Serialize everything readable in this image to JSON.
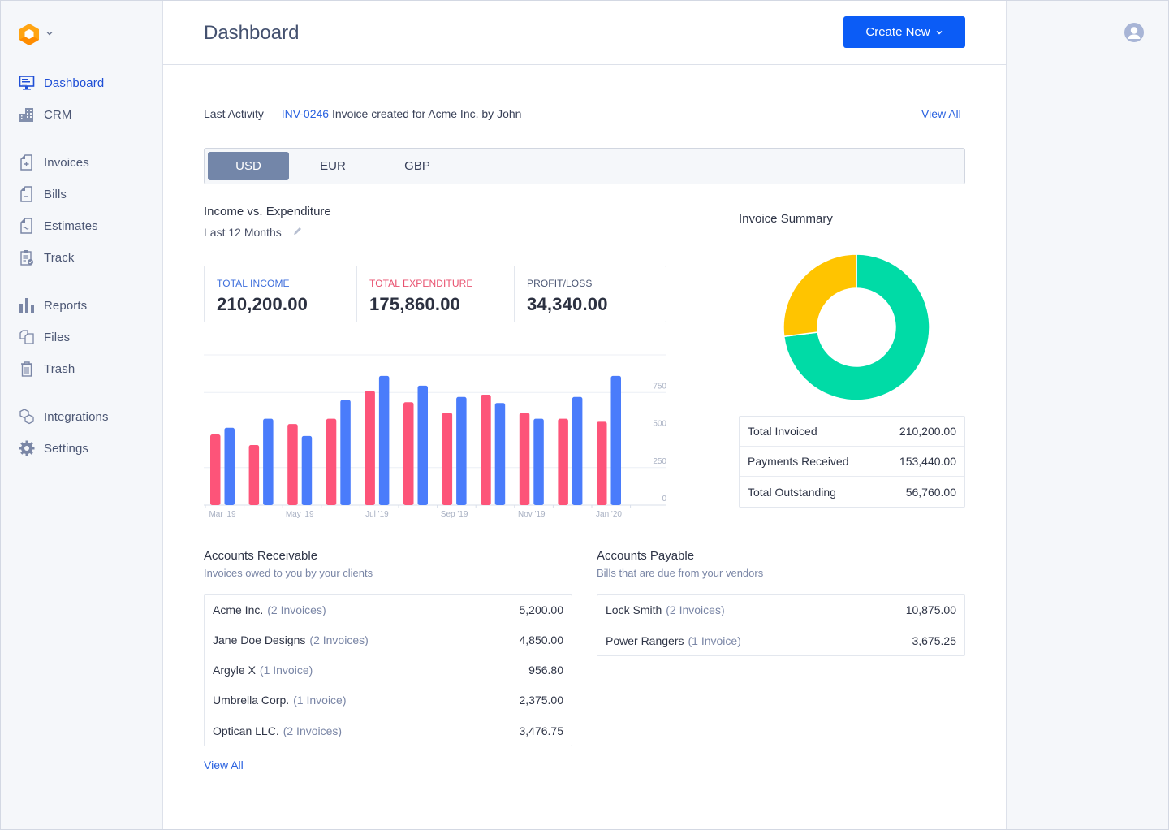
{
  "app": {
    "logo_icon": "hexagon-logo-icon",
    "avatar_icon": "user-avatar-icon"
  },
  "sidebar": {
    "items": [
      {
        "label": "Dashboard",
        "icon": "monitor-icon",
        "active": true
      },
      {
        "label": "CRM",
        "icon": "buildings-icon",
        "active": false
      },
      {
        "label": "Invoices",
        "icon": "document-plus-icon",
        "active": false
      },
      {
        "label": "Bills",
        "icon": "document-minus-icon",
        "active": false
      },
      {
        "label": "Estimates",
        "icon": "document-tilde-icon",
        "active": false
      },
      {
        "label": "Track",
        "icon": "clipboard-check-icon",
        "active": false
      },
      {
        "label": "Reports",
        "icon": "bar-chart-icon",
        "active": false
      },
      {
        "label": "Files",
        "icon": "files-icon",
        "active": false
      },
      {
        "label": "Trash",
        "icon": "trash-icon",
        "active": false
      },
      {
        "label": "Integrations",
        "icon": "integrations-icon",
        "active": false
      },
      {
        "label": "Settings",
        "icon": "gear-icon",
        "active": false
      }
    ]
  },
  "header": {
    "title": "Dashboard",
    "create_button": "Create New"
  },
  "activity": {
    "prefix": "Last Activity —",
    "invoice_id": "INV-0246",
    "text": "Invoice created for Acme Inc. by John",
    "view_all": "View All"
  },
  "currency_tabs": [
    {
      "label": "USD",
      "active": true
    },
    {
      "label": "EUR",
      "active": false
    },
    {
      "label": "GBP",
      "active": false
    }
  ],
  "income": {
    "title": "Income vs. Expenditure",
    "period": "Last 12 Months",
    "stats": [
      {
        "key": "TOTAL INCOME",
        "value": "210,200.00",
        "color": "#3f6fdc"
      },
      {
        "key": "TOTAL EXPENDITURE",
        "value": "175,860.00",
        "color": "#e8516f"
      },
      {
        "key": "PROFIT/LOSS",
        "value": "34,340.00",
        "color": "#4c5774"
      }
    ]
  },
  "chart_data": {
    "type": "bar",
    "title": "Income vs. Expenditure",
    "categories": [
      "Mar '19",
      "Apr '19",
      "May '19",
      "Jun '19",
      "Jul '19",
      "Aug '19",
      "Sep '19",
      "Oct '19",
      "Nov '19",
      "Dec '19",
      "Jan '20"
    ],
    "x_tick_labels": [
      "Mar '19",
      "May '19",
      "Jul '19",
      "Sep '19",
      "Nov '19",
      "Jan '20"
    ],
    "series": [
      {
        "name": "Expenditure",
        "color": "#fd5479",
        "values": [
          470,
          400,
          540,
          575,
          760,
          685,
          615,
          735,
          615,
          575,
          555
        ]
      },
      {
        "name": "Income",
        "color": "#4a7cfb",
        "values": [
          515,
          575,
          460,
          700,
          860,
          795,
          720,
          680,
          575,
          720,
          860
        ]
      }
    ],
    "y_ticks": [
      0,
      250,
      500,
      750
    ],
    "ylim": [
      0,
      1000
    ],
    "y_axis_side": "right",
    "grid": true,
    "xlabel": "",
    "ylabel": ""
  },
  "invoice_summary": {
    "title": "Invoice Summary",
    "donut": [
      {
        "name": "Payments Received",
        "value": 153440,
        "color": "#00dba6"
      },
      {
        "name": "Total Outstanding",
        "value": 56760,
        "color": "#ffc400"
      }
    ],
    "rows": [
      {
        "label": "Total Invoiced",
        "value": "210,200.00"
      },
      {
        "label": "Payments Received",
        "value": "153,440.00"
      },
      {
        "label": "Total Outstanding",
        "value": "56,760.00"
      }
    ]
  },
  "receivable": {
    "title": "Accounts Receivable",
    "subtitle": "Invoices owed to you by your clients",
    "rows": [
      {
        "name": "Acme Inc.",
        "count": "(2 Invoices)",
        "amount": "5,200.00"
      },
      {
        "name": "Jane Doe Designs",
        "count": "(2 Invoices)",
        "amount": "4,850.00"
      },
      {
        "name": "Argyle X",
        "count": "(1 Invoice)",
        "amount": "956.80"
      },
      {
        "name": "Umbrella Corp.",
        "count": "(1 Invoice)",
        "amount": "2,375.00"
      },
      {
        "name": "Optican LLC.",
        "count": "(2 Invoices)",
        "amount": "3,476.75"
      }
    ],
    "view_all": "View All"
  },
  "payable": {
    "title": "Accounts Payable",
    "subtitle": "Bills that are due from your vendors",
    "rows": [
      {
        "name": "Lock Smith",
        "count": "(2 Invoices)",
        "amount": "10,875.00"
      },
      {
        "name": "Power Rangers",
        "count": "(1 Invoice)",
        "amount": "3,675.25"
      }
    ]
  }
}
